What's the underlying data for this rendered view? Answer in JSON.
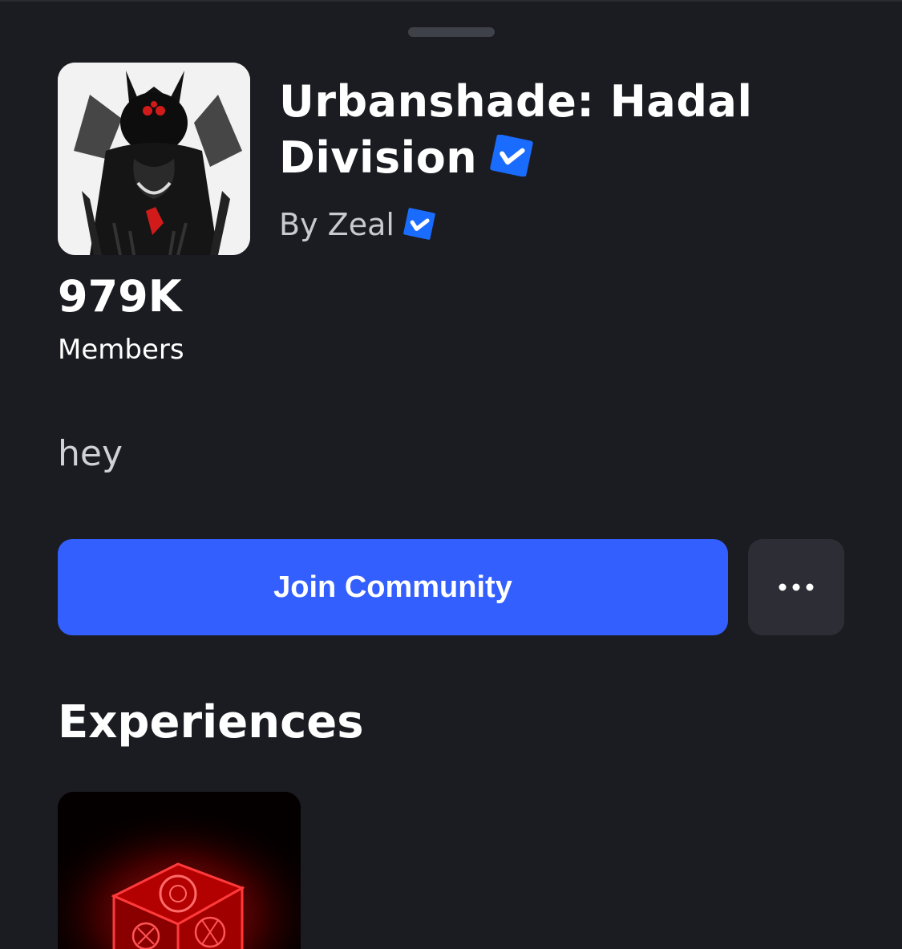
{
  "group": {
    "name": "Urbanshade: Hadal Division",
    "owner_prefix": "By",
    "owner": "Zeal",
    "member_count": "979K",
    "member_label": "Members",
    "description": "hey",
    "icon": "group-emblem-image",
    "verified_icon": "verified-check-icon"
  },
  "actions": {
    "join_label": "Join Community",
    "more_icon": "ellipsis-icon"
  },
  "experiences": {
    "title": "Experiences",
    "items": [
      {
        "thumbnail": "red-glowing-cube-image"
      }
    ]
  },
  "colors": {
    "background": "#1b1c21",
    "accent": "#335fff",
    "verified": "#1a6cff",
    "secondary_button": "#2d2e35"
  }
}
